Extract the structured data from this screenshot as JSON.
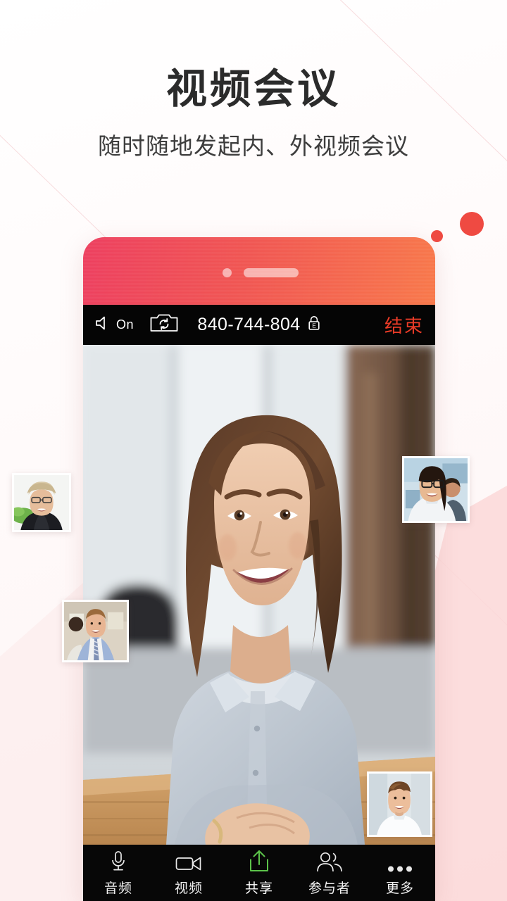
{
  "page": {
    "title": "视频会议",
    "subtitle": "随时随地发起内、外视频会议"
  },
  "colors": {
    "accent_red": "#ed3f5f",
    "accent_orange": "#f8784a",
    "end_button_red": "#ea3b27",
    "share_green": "#5cc44a",
    "bar_black": "#050505",
    "dot_red": "#ef4a42",
    "wedge_pink": "#fcd8d8"
  },
  "phone": {
    "appbar": {
      "speaker_icon": "speaker-icon",
      "speaker_state": "On",
      "switch_camera_icon": "switch-camera-icon",
      "meeting_id": "840-744-804",
      "lock_icon": "lock-encrypted-icon",
      "lock_letter": "E",
      "end_label": "结束"
    },
    "toolbar": [
      {
        "icon": "microphone-icon",
        "label": "音频",
        "active": false
      },
      {
        "icon": "video-camera-icon",
        "label": "视频",
        "active": false
      },
      {
        "icon": "share-upload-icon",
        "label": "共享",
        "active": true
      },
      {
        "icon": "participants-icon",
        "label": "参与者",
        "active": false
      },
      {
        "icon": "more-dots-icon",
        "label": "更多",
        "active": false
      }
    ],
    "main_video": {
      "name": "active-speaker-video",
      "description": "smiling woman in light blue shirt seated at desk"
    },
    "thumbnails": [
      {
        "name": "participant-thumb-left",
        "description": "older blonde woman with glasses in dark blazer"
      },
      {
        "name": "participant-thumb-man",
        "description": "man in blue shirt and striped tie in office"
      },
      {
        "name": "participant-thumb-right",
        "description": "woman with glasses in white shirt, colleague behind"
      },
      {
        "name": "participant-thumb-bottom-right",
        "description": "young man in white shirt"
      }
    ]
  }
}
